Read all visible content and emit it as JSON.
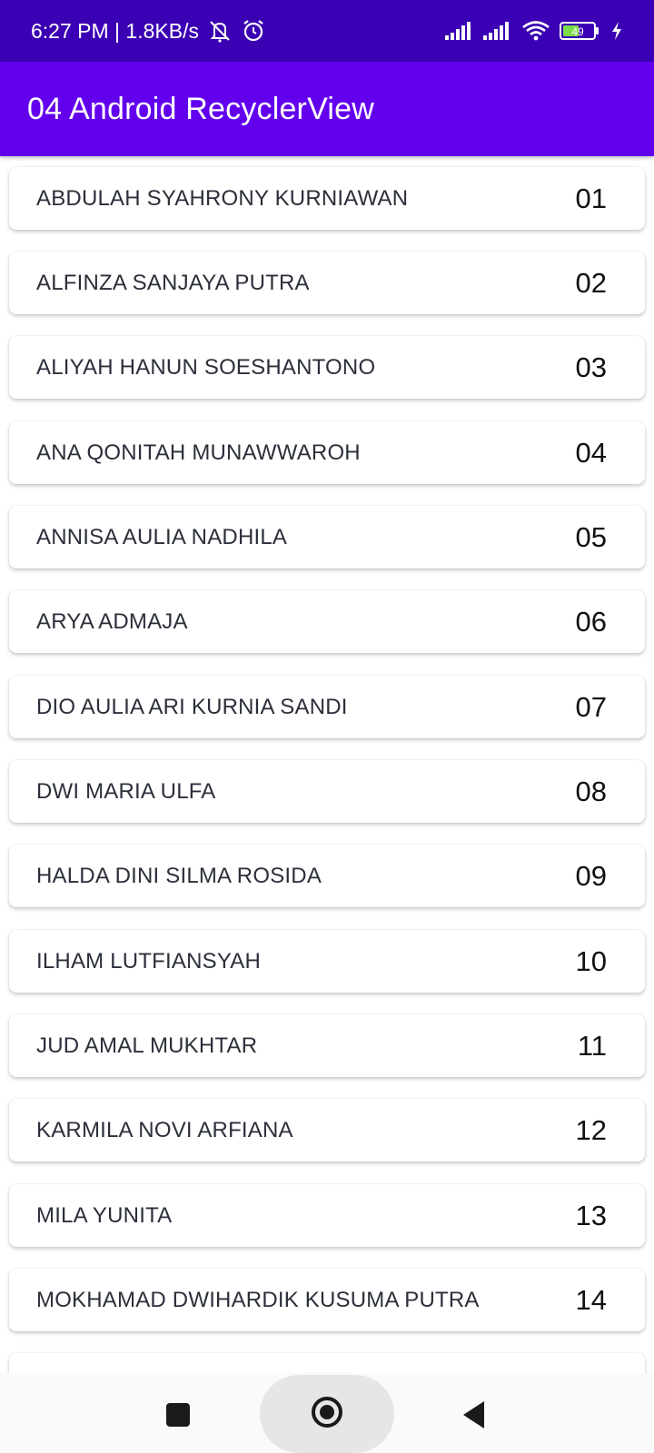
{
  "status_bar": {
    "time_speed": "6:27 PM | 1.8KB/s",
    "battery_level": "49",
    "icons": [
      "mute-bell-icon",
      "alarm-icon",
      "signal-icon",
      "signal-icon",
      "wifi-icon",
      "battery-icon",
      "charging-bolt-icon"
    ]
  },
  "app_bar": {
    "title": "04 Android RecyclerView",
    "color": "#6200ee"
  },
  "items": [
    {
      "name": "ABDULAH SYAHRONY KURNIAWAN",
      "number": "01"
    },
    {
      "name": "ALFINZA SANJAYA PUTRA",
      "number": "02"
    },
    {
      "name": "ALIYAH HANUN SOESHANTONO",
      "number": "03"
    },
    {
      "name": "ANA QONITAH MUNAWWAROH",
      "number": "04"
    },
    {
      "name": "ANNISA AULIA NADHILA",
      "number": "05"
    },
    {
      "name": "ARYA ADMAJA",
      "number": "06"
    },
    {
      "name": "DIO AULIA ARI KURNIA SANDI",
      "number": "07"
    },
    {
      "name": "DWI MARIA ULFA",
      "number": "08"
    },
    {
      "name": "HALDA DINI SILMA ROSIDA",
      "number": "09"
    },
    {
      "name": "ILHAM LUTFIANSYAH",
      "number": "10"
    },
    {
      "name": "JUD AMAL MUKHTAR",
      "number": "11"
    },
    {
      "name": "KARMILA NOVI ARFIANA",
      "number": "12"
    },
    {
      "name": "MILA YUNITA",
      "number": "13"
    },
    {
      "name": "MOKHAMAD DWIHARDIK KUSUMA PUTRA",
      "number": "14"
    },
    {
      "name": "",
      "number": ""
    }
  ],
  "nav_bar": {
    "icons": [
      "recents-square-icon",
      "home-circle-icon",
      "back-triangle-icon"
    ]
  }
}
